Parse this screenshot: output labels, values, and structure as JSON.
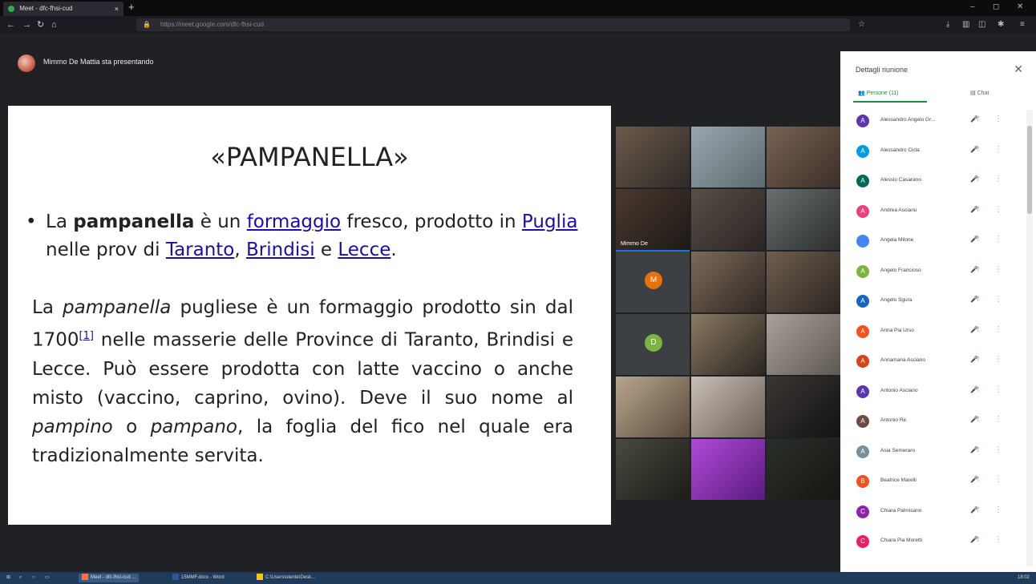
{
  "browser": {
    "tab_title": "Meet - dfc-fhsi-cud",
    "tab_close": "×",
    "new_tab": "+",
    "url": "https://meet.google.com/dfc-fhsi-cud",
    "window_controls": [
      "–",
      "◻",
      "✕"
    ]
  },
  "presenter": {
    "status": "Mimmo De Mattia sta presentando"
  },
  "slide": {
    "title": "«PAMPANELLA»",
    "bullet": {
      "t1": "La ",
      "b1": "pampanella",
      "t2": " è un ",
      "l1": "formaggio",
      "t3": " fresco, prodotto in ",
      "l2": "Puglia",
      "t4": " nelle prov di ",
      "l3": "Taranto",
      "t5": ", ",
      "l4": "Brindisi",
      "t6": " e ",
      "l5": "Lecce",
      "t7": "."
    },
    "para": {
      "p1": "La ",
      "i1": "pampanella",
      "p2": " pugliese è un formaggio prodotto sin dal 1700",
      "ref": "[1]",
      "p3": " nelle masserie delle Province di Taranto, Brindisi e Lecce. Può essere prodotta con latte vaccino o anche misto (vaccino, caprino, ovino). Deve il suo nome al ",
      "i2": "pampino",
      "p4": " o ",
      "i3": "pampano",
      "p5": ", la foglia del fico nel quale era tradizionalmente servita."
    }
  },
  "video_grid": {
    "tiles": [
      {
        "initial": ""
      },
      {
        "initial": ""
      },
      {
        "initial": ""
      },
      {
        "initial": "",
        "label": "Mimmo De"
      },
      {
        "initial": ""
      },
      {
        "initial": ""
      },
      {
        "initial": "M"
      },
      {
        "initial": ""
      },
      {
        "initial": ""
      },
      {
        "initial": "D"
      },
      {
        "initial": ""
      },
      {
        "initial": ""
      },
      {
        "initial": ""
      },
      {
        "initial": ""
      },
      {
        "initial": ""
      },
      {
        "initial": ""
      },
      {
        "initial": ""
      },
      {
        "initial": ""
      }
    ]
  },
  "panel": {
    "title": "Dettagli riunione",
    "close": "✕",
    "tab_people": "Persone (11)",
    "tab_chat": "Chat",
    "participants": [
      {
        "initial": "A",
        "name": "Alessandro Angelo Gr...",
        "color": "#5e35b1"
      },
      {
        "initial": "A",
        "name": "Alessandro Cicla",
        "color": "#039be5"
      },
      {
        "initial": "A",
        "name": "Alessio Casarano",
        "color": "#00695c"
      },
      {
        "initial": "A",
        "name": "Andrea Ascianu",
        "color": "#ec407a"
      },
      {
        "initial": "",
        "name": "Angela Milone",
        "color": "#4285f4"
      },
      {
        "initial": "A",
        "name": "Angelo Francioso",
        "color": "#7cb342"
      },
      {
        "initial": "A",
        "name": "Angelo Sgura",
        "color": "#1565c0"
      },
      {
        "initial": "A",
        "name": "Anna Pia Urso",
        "color": "#f4511e"
      },
      {
        "initial": "A",
        "name": "Annamaria Asciano",
        "color": "#d84315"
      },
      {
        "initial": "A",
        "name": "Antonio Asciano",
        "color": "#5e35b1"
      },
      {
        "initial": "A",
        "name": "Antonio Re",
        "color": "#6d4c41"
      },
      {
        "initial": "A",
        "name": "Asia Semeraro",
        "color": "#78909c"
      },
      {
        "initial": "B",
        "name": "Beatrice Marelli",
        "color": "#f4511e"
      },
      {
        "initial": "C",
        "name": "Chiara Palmisano",
        "color": "#8e24aa"
      },
      {
        "initial": "C",
        "name": "Chiara Pia Moretti",
        "color": "#e91e63"
      }
    ]
  },
  "taskbar": {
    "items": [
      "Meet - dfc-fhsi-cud ...",
      "15MMF.docx - Word",
      "C:\\Users\\utente\\Desk..."
    ],
    "time": "18:02"
  }
}
